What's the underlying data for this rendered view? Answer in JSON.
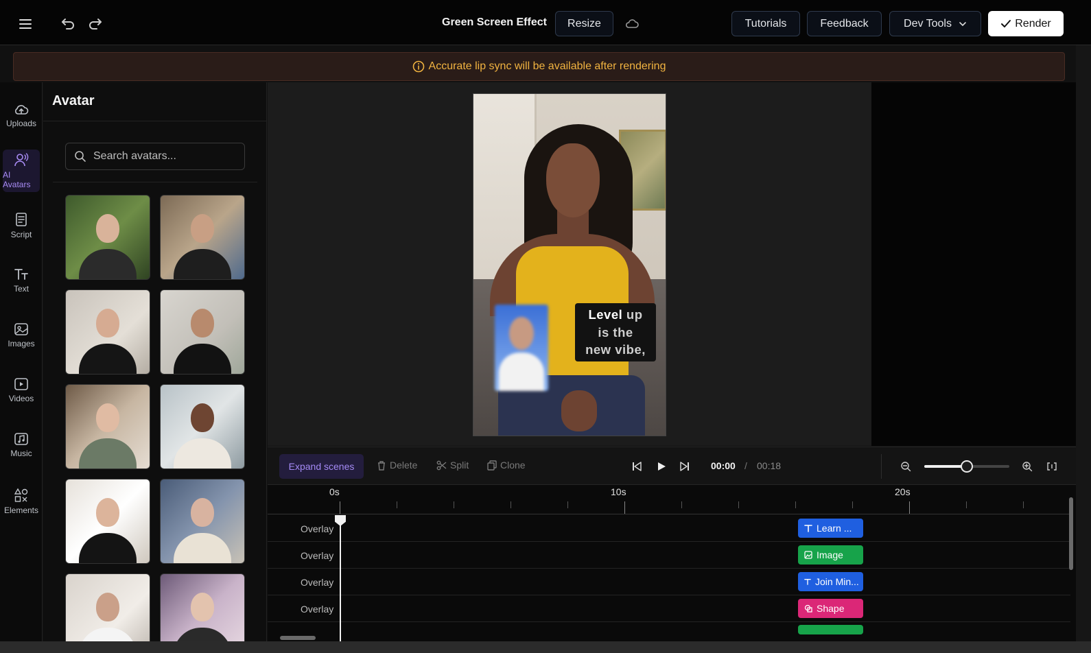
{
  "topbar": {
    "project_title": "Green Screen Effect",
    "resize_label": "Resize",
    "tutorials_label": "Tutorials",
    "feedback_label": "Feedback",
    "devtools_label": "Dev Tools",
    "render_label": "Render"
  },
  "notice": {
    "text": "Accurate lip sync will be available after rendering",
    "color": "#f1b340"
  },
  "rail": {
    "items": [
      {
        "label": "Uploads",
        "icon": "upload-cloud-icon"
      },
      {
        "label": "AI Avatars",
        "icon": "avatar-voice-icon",
        "active": true
      },
      {
        "label": "Script",
        "icon": "script-icon"
      },
      {
        "label": "Text",
        "icon": "text-icon"
      },
      {
        "label": "Images",
        "icon": "images-icon"
      },
      {
        "label": "Videos",
        "icon": "videos-icon"
      },
      {
        "label": "Music",
        "icon": "music-icon"
      },
      {
        "label": "Elements",
        "icon": "elements-icon"
      }
    ],
    "accent": "#a98cf5"
  },
  "panel": {
    "title": "Avatar",
    "search_placeholder": "Search avatars..."
  },
  "preview": {
    "caption": {
      "w1": "Level",
      "w2": "up",
      "w3": "is",
      "w4": "the",
      "w5": "new",
      "w6": "vibe,"
    }
  },
  "timeline_toolbar": {
    "expand_label": "Expand scenes",
    "delete_label": "Delete",
    "split_label": "Split",
    "clone_label": "Clone",
    "current_time": "00:00",
    "separator": "/",
    "total_time": "00:18",
    "zoom_level": 0.5
  },
  "timeline": {
    "ruler": [
      "0s",
      "10s",
      "20s"
    ],
    "rows": [
      {
        "label": "Overlay",
        "clip": "Learn ...",
        "color": "#1f5fe0",
        "icon": "text-icon"
      },
      {
        "label": "Overlay",
        "clip": "Image",
        "color": "#17a34a",
        "icon": "image-icon"
      },
      {
        "label": "Overlay",
        "clip": "Join Min...",
        "color": "#1f5fe0",
        "icon": "text-icon"
      },
      {
        "label": "Overlay",
        "clip": "Shape",
        "color": "#db2777",
        "icon": "shape-icon"
      }
    ]
  }
}
